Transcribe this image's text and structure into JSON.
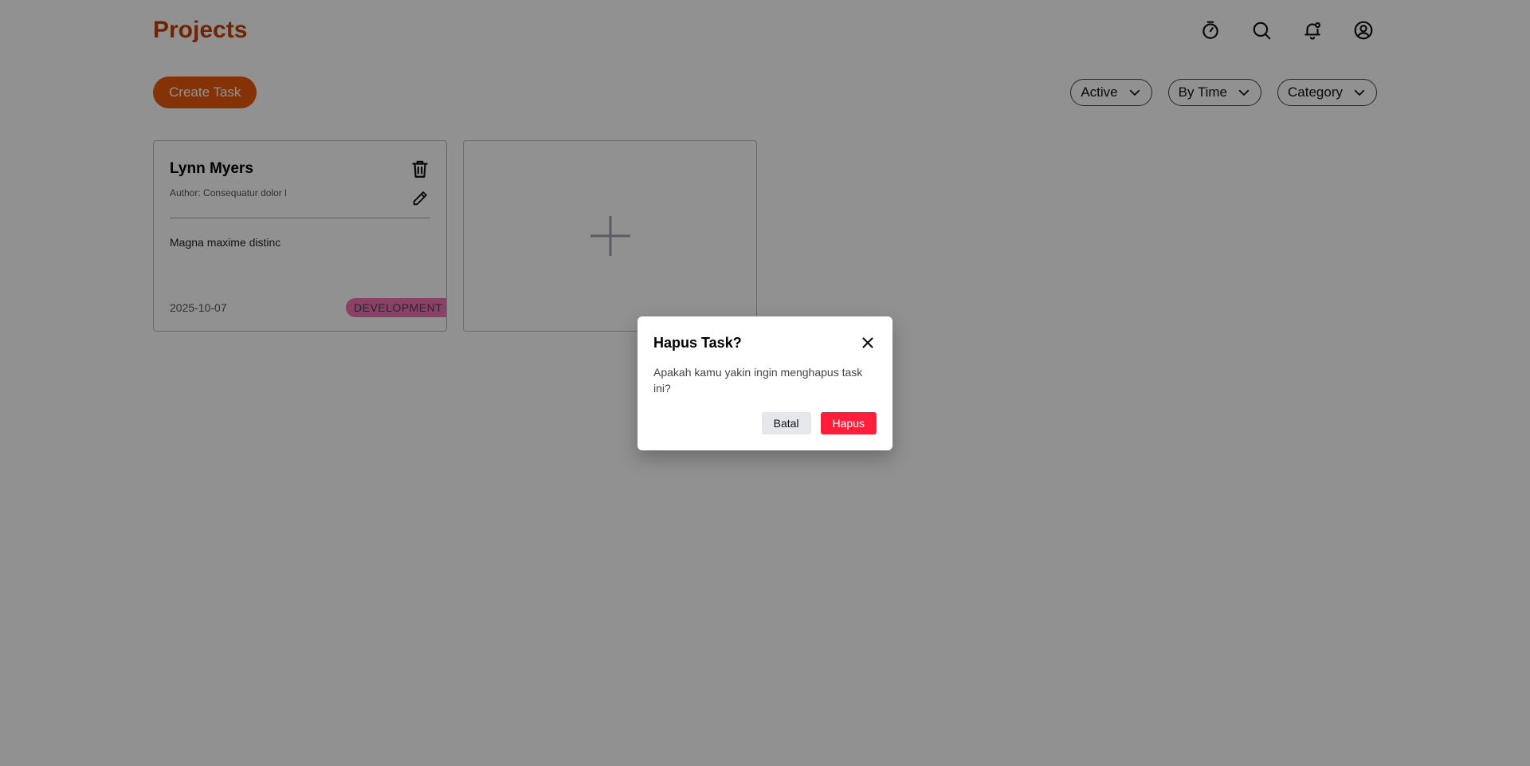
{
  "header": {
    "title": "Projects",
    "icons": [
      "timer-icon",
      "search-icon",
      "notification-bell-icon",
      "user-profile-icon"
    ]
  },
  "toolbar": {
    "create_label": "Create Task",
    "filters": [
      {
        "label": "Active"
      },
      {
        "label": "By Time"
      },
      {
        "label": "Category"
      }
    ]
  },
  "cards": [
    {
      "name": "Lynn Myers",
      "author": "Author: Consequatur dolor l",
      "description": "Magna maxime distinc",
      "date": "2025-10-07",
      "category": "DEVELOPMENT"
    }
  ],
  "modal": {
    "title": "Hapus Task?",
    "message": "Apakah kamu yakin ingin menghapus task ini?",
    "cancel_label": "Batal",
    "delete_label": "Hapus"
  },
  "colors": {
    "brand": "#EA580C",
    "title": "#C2410C",
    "badge": "#F472B6",
    "danger": "#FF1F3A",
    "overlay": "rgba(0,0,0,0.43)"
  }
}
